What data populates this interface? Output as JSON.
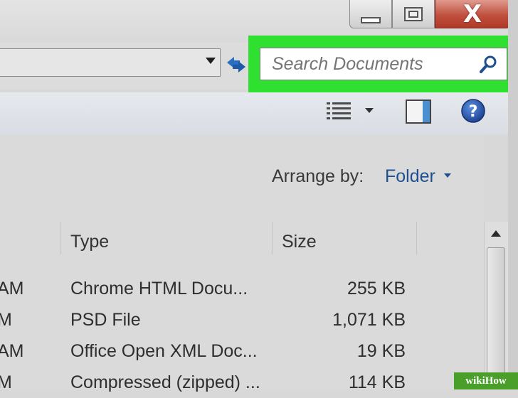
{
  "window": {
    "minimize_icon": "minimize-icon",
    "maximize_icon": "maximize-icon",
    "close_icon": "close-icon",
    "close_glyph": "X",
    "close_color": "#c0503e"
  },
  "navigation": {
    "dropdown_icon": "chevron-down-icon",
    "refresh_icon": "refresh-icon"
  },
  "search": {
    "placeholder": "Search Documents",
    "value": "",
    "icon": "search-icon",
    "highlight_color": "#30e030"
  },
  "toolbar": {
    "views_icon": "views-list-icon",
    "preview_icon": "preview-pane-icon",
    "help_icon": "help-icon",
    "help_glyph": "?"
  },
  "arrange": {
    "label": "Arrange by:",
    "value": "Folder"
  },
  "file_list": {
    "columns": [
      "Type",
      "Size"
    ],
    "rows": [
      {
        "modified_fragment": "AM",
        "type": "Chrome HTML Docu...",
        "size": "255 KB"
      },
      {
        "modified_fragment": "M",
        "type": "PSD File",
        "size": "1,071 KB"
      },
      {
        "modified_fragment": "AM",
        "type": "Office Open XML Doc...",
        "size": "19 KB"
      },
      {
        "modified_fragment": "M",
        "type": "Compressed (zipped) ...",
        "size": "114 KB"
      }
    ]
  },
  "watermark": "wikiHow"
}
